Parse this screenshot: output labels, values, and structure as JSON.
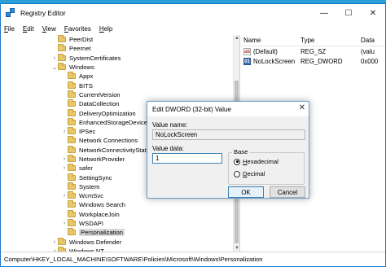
{
  "window": {
    "title": "Registry Editor",
    "controls": {
      "minimize": "—",
      "maximize": "☐",
      "close": "✕"
    }
  },
  "menu": [
    {
      "label": "File",
      "hotkey": "F",
      "rest": "ile"
    },
    {
      "label": "Edit",
      "hotkey": "E",
      "rest": "dit"
    },
    {
      "label": "View",
      "hotkey": "V",
      "rest": "iew"
    },
    {
      "label": "Favorites",
      "hotkey": "F",
      "rest": "avorites"
    },
    {
      "label": "Help",
      "hotkey": "H",
      "rest": "elp"
    }
  ],
  "tree": [
    {
      "label": "PeerDist",
      "level": 1,
      "expander": ""
    },
    {
      "label": "Peernet",
      "level": 1,
      "expander": ""
    },
    {
      "label": "SystemCertificates",
      "level": 1,
      "expander": ">"
    },
    {
      "label": "Windows",
      "level": 1,
      "expander": "v"
    },
    {
      "label": "Appx",
      "level": 2,
      "expander": ""
    },
    {
      "label": "BITS",
      "level": 2,
      "expander": ""
    },
    {
      "label": "CurrentVersion",
      "level": 2,
      "expander": ""
    },
    {
      "label": "DataCollection",
      "level": 2,
      "expander": ""
    },
    {
      "label": "DeliveryOptimization",
      "level": 2,
      "expander": ""
    },
    {
      "label": "EnhancedStorageDevices",
      "level": 2,
      "expander": ""
    },
    {
      "label": "IPSec",
      "level": 2,
      "expander": ">"
    },
    {
      "label": "Network Connections",
      "level": 2,
      "expander": ""
    },
    {
      "label": "NetworkConnectivityStatusIndicator",
      "level": 2,
      "expander": ""
    },
    {
      "label": "NetworkProvider",
      "level": 2,
      "expander": ">"
    },
    {
      "label": "safer",
      "level": 2,
      "expander": ">"
    },
    {
      "label": "SettingSync",
      "level": 2,
      "expander": ""
    },
    {
      "label": "System",
      "level": 2,
      "expander": ""
    },
    {
      "label": "WcmSvc",
      "level": 2,
      "expander": ">"
    },
    {
      "label": "Windows Search",
      "level": 2,
      "expander": ""
    },
    {
      "label": "WorkplaceJoin",
      "level": 2,
      "expander": ""
    },
    {
      "label": "WSDAPI",
      "level": 2,
      "expander": ">"
    },
    {
      "label": "Personalization",
      "level": 2,
      "expander": "",
      "selected": true
    },
    {
      "label": "Windows Defender",
      "level": 1,
      "expander": ">"
    },
    {
      "label": "Windows NT",
      "level": 1,
      "expander": ">"
    }
  ],
  "values_pane": {
    "columns": {
      "name": "Name",
      "type": "Type",
      "data": "Data"
    },
    "rows": [
      {
        "icon": "ab",
        "name": "(Default)",
        "type": "REG_SZ",
        "data": "(valu"
      },
      {
        "icon": "01",
        "name": "NoLockScreen",
        "type": "REG_DWORD",
        "data": "0x000"
      }
    ]
  },
  "statusbar": {
    "path": "Computer\\HKEY_LOCAL_MACHINE\\SOFTWARE\\Policies\\Microsoft\\Windows\\Personalization"
  },
  "dialog": {
    "title": "Edit DWORD (32-bit) Value",
    "close": "✕",
    "value_name_label": "Value name:",
    "value_name": "NoLockScreen",
    "value_data_label": "Value data:",
    "value_data": "1",
    "base_label": "Base",
    "base_options": [
      {
        "hotkey": "H",
        "rest": "exadecimal",
        "selected": true
      },
      {
        "hotkey": "D",
        "rest": "ecimal",
        "selected": false
      }
    ],
    "ok_label": "OK",
    "cancel_label": "Cancel"
  },
  "colors": {
    "desktop": "#1f8fcc",
    "accent": "#3c7fb1",
    "folder": "#e8c66a"
  }
}
